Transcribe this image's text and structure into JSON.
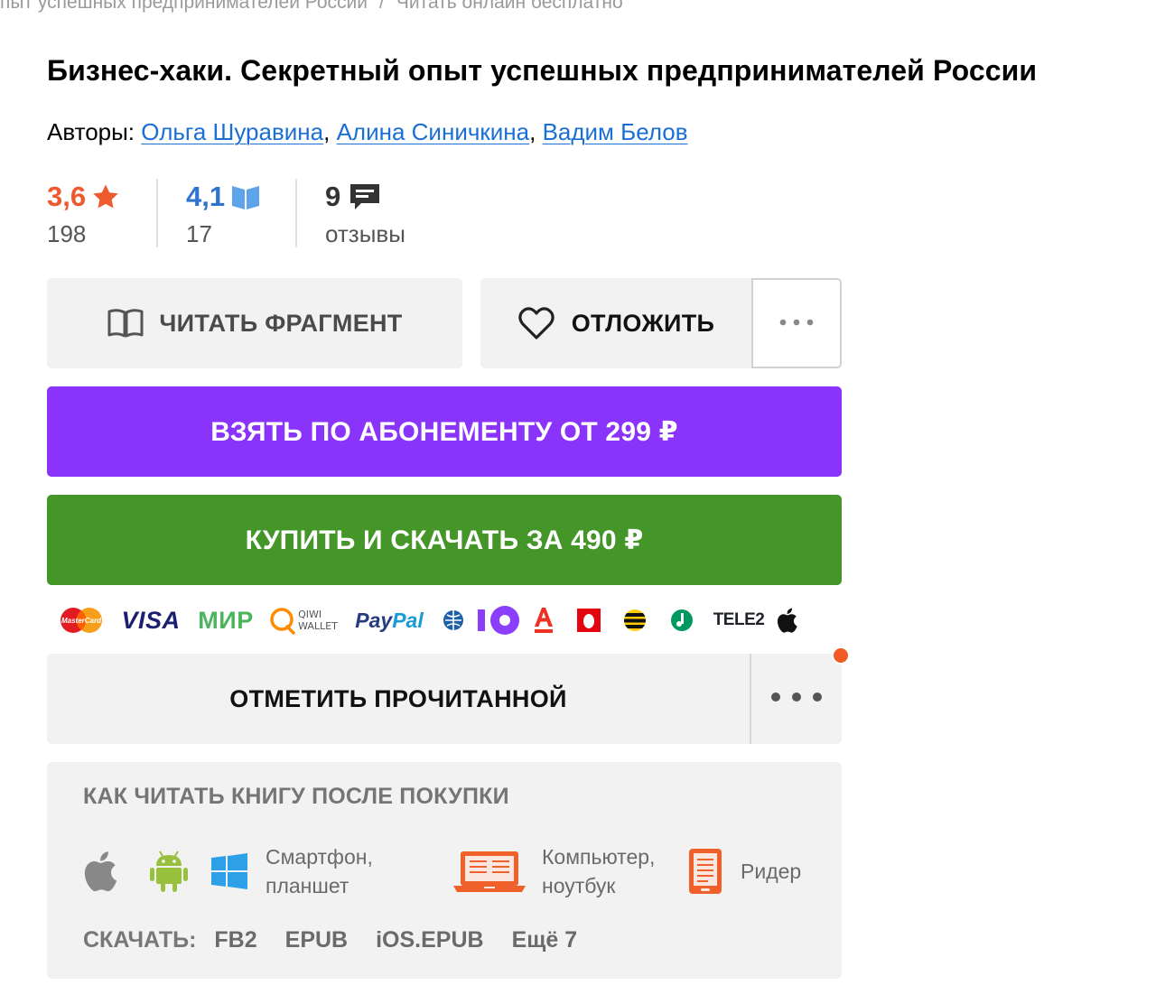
{
  "breadcrumb": {
    "prev": "пыт успешных предпринимателей России",
    "separator": "/",
    "current": "Читать онлайн бесплатно"
  },
  "book": {
    "title": "Бизнес-хаки. Секретный опыт успешных предпринимателей России",
    "authors_label": "Авторы:",
    "authors": [
      "Ольга Шуравина",
      "Алина Синичкина",
      "Вадим Белов"
    ]
  },
  "ratings": {
    "litres": {
      "value": "3,6",
      "count": "198",
      "color": "#ee5a2e",
      "icon": "star-icon"
    },
    "livelib": {
      "value": "4,1",
      "count": "17",
      "color": "#2e74cf",
      "icon": "book-icon"
    },
    "reviews": {
      "value": "9",
      "label": "отзывы",
      "icon": "comment-icon"
    }
  },
  "actions": {
    "read_fragment": "ЧИТАТЬ ФРАГМЕНТ",
    "postpone": "ОТЛОЖИТЬ",
    "subscribe": "ВЗЯТЬ ПО АБОНЕМЕНТУ ОТ 299 ₽",
    "buy": "КУПИТЬ И СКАЧАТЬ ЗА 490 ₽",
    "mark_read": "ОТМЕТИТЬ ПРОЧИТАННОЙ",
    "subscribe_color": "#8a33fb",
    "buy_color": "#459629"
  },
  "payments": {
    "visa": "VISA",
    "mir": "МИР",
    "qiwi_top": "QIWI",
    "qiwi_bottom": "WALLET",
    "paypal_a": "Pay",
    "paypal_b": "Pal",
    "tele2": "TELE2",
    "mastercard": "MasterCard"
  },
  "howto": {
    "title": "КАК ЧИТАТЬ КНИГУ ПОСЛЕ ПОКУПКИ",
    "smartphone_line1": "Смартфон,",
    "smartphone_line2": "планшет",
    "computer_line1": "Компьютер,",
    "computer_line2": "ноутбук",
    "reader": "Ридер",
    "download_label": "СКАЧАТЬ:",
    "formats": [
      "FB2",
      "EPUB",
      "iOS.EPUB",
      "Ещё 7"
    ]
  }
}
